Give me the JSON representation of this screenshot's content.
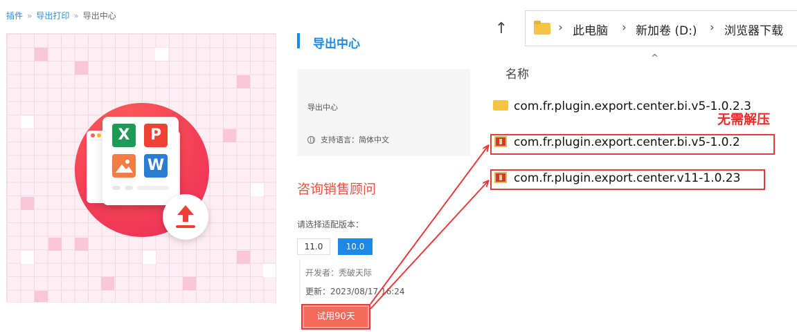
{
  "breadcrumb": {
    "item1": "插件",
    "item2": "导出打印",
    "item3": "导出中心",
    "sep": "»"
  },
  "hero": {
    "tiles": [
      "X",
      "P",
      "W"
    ]
  },
  "product": {
    "title": "导出中心",
    "description": "导出中心",
    "language": "支持语言：简体中文",
    "consult": "咨询销售顾问",
    "version_label": "请选择适配版本：",
    "versions": [
      "11.0",
      "10.0"
    ],
    "selected_version": "10.0",
    "developer": "开发者：秃破天际",
    "updated": "更新：2023/08/17 16:24",
    "trial_button": "试用90天"
  },
  "explorer": {
    "up_icon": "↑",
    "path": [
      "此电脑",
      "新加卷 (D:)",
      "浏览器下载"
    ],
    "column_name": "名称",
    "files": [
      {
        "name": "com.fr.plugin.export.center.bi.v5-1.0.2.3",
        "icon": "folder-icon"
      },
      {
        "name": "com.fr.plugin.export.center.bi.v5-1.0.2",
        "icon": "zip-icon"
      },
      {
        "name": "com.fr.plugin.export.center.v11-1.0.23",
        "icon": "zip-icon"
      }
    ]
  },
  "annotation": "无需解压",
  "colors": {
    "accent": "#1e88e5",
    "highlight": "#e63939",
    "trial": "#f7695b"
  }
}
